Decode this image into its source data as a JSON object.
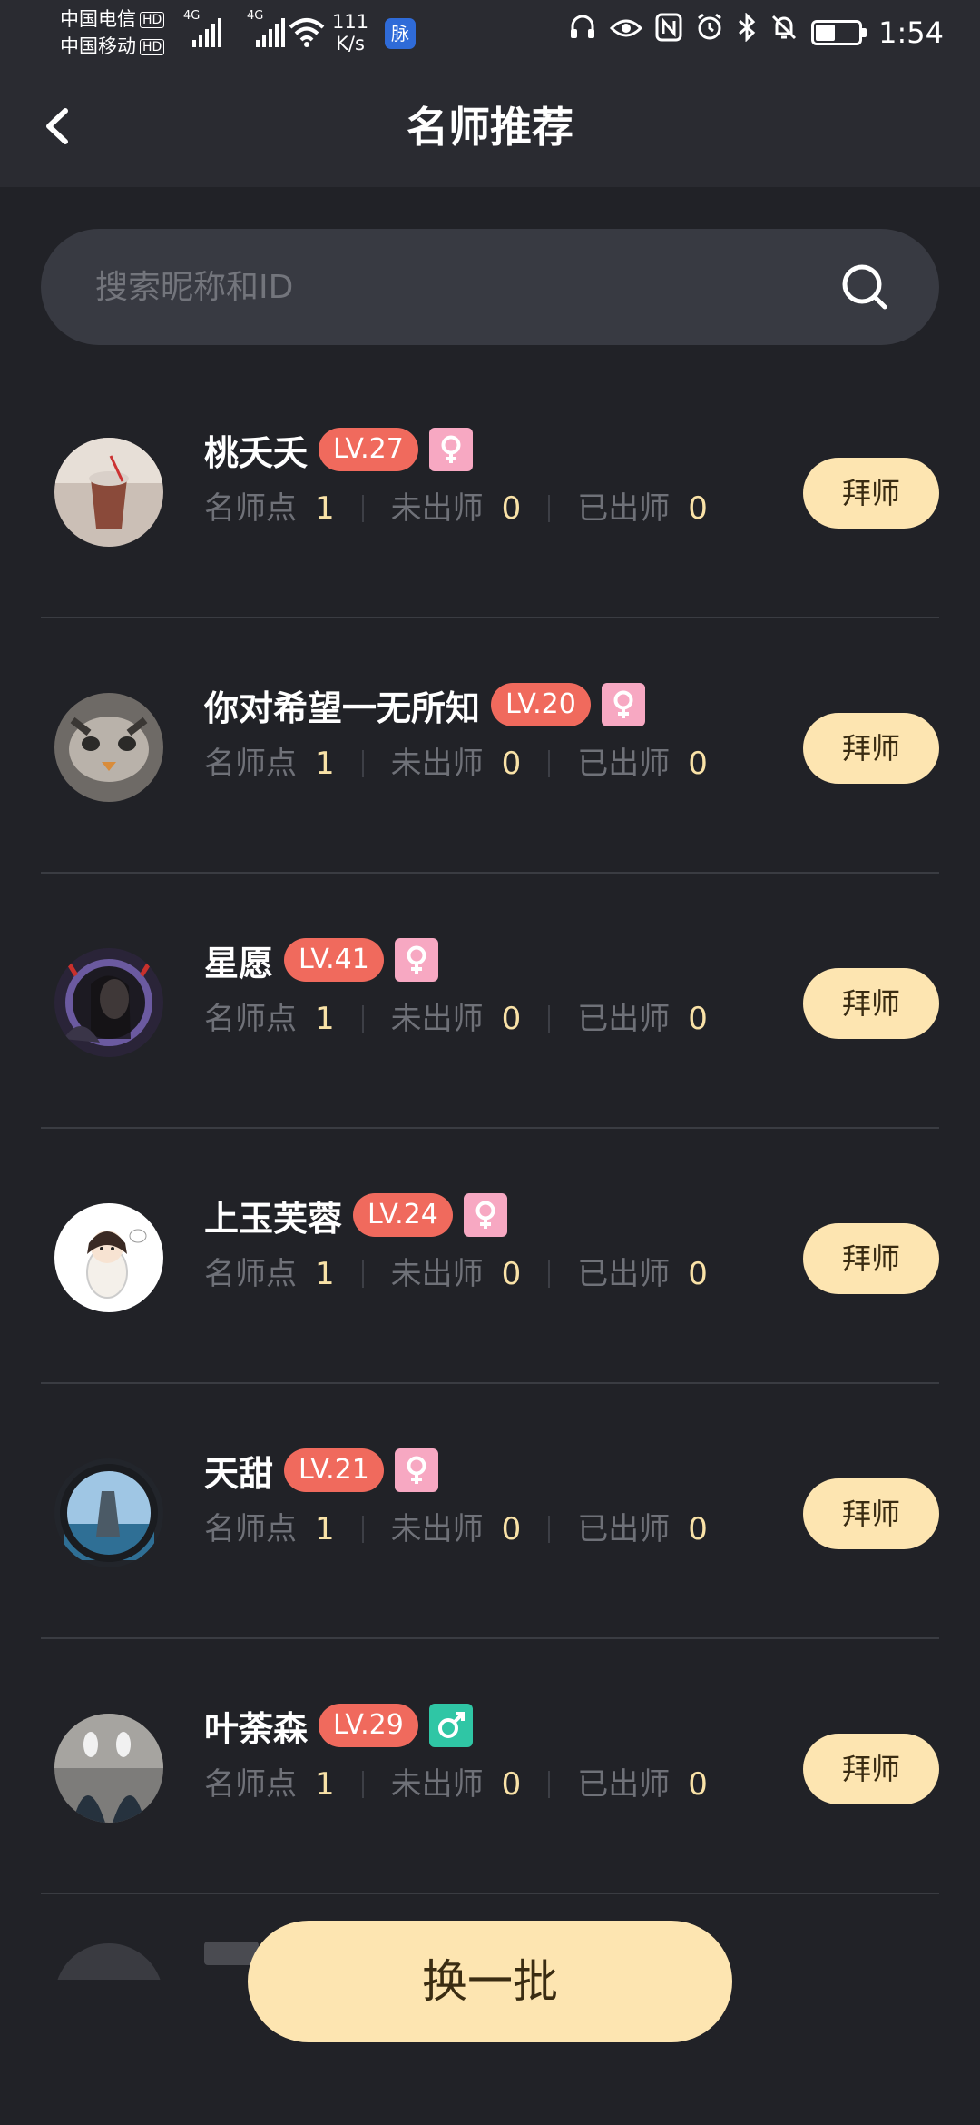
{
  "status_bar": {
    "carrier1": "中国电信",
    "carrier2": "中国移动",
    "hd": "HD",
    "net1": "4G",
    "net2": "4G",
    "speed_value": "111",
    "speed_unit": "K/s",
    "app_badge": "脉",
    "battery_level": 0.45,
    "time": "1:54",
    "icons": [
      "headphones-icon",
      "eye-icon",
      "nfc-icon",
      "alarm-icon",
      "bluetooth-icon",
      "mute-icon",
      "battery-icon"
    ]
  },
  "nav": {
    "title": "名师推荐",
    "back_icon": "chevron-left-icon"
  },
  "search": {
    "placeholder": "搜索昵称和ID",
    "value": "",
    "icon": "search-icon"
  },
  "labels": {
    "points": "名师点",
    "unfinished": "未出师",
    "finished": "已出师",
    "apprentice_button": "拜师",
    "swap_button": "换一批"
  },
  "masters": [
    {
      "name": "桃夭夭",
      "level": "LV.27",
      "gender": "female",
      "gender_symbol": "♀",
      "points": "1",
      "unfinished": "0",
      "finished": "0"
    },
    {
      "name": "你对希望一无所知",
      "level": "LV.20",
      "gender": "female",
      "gender_symbol": "♀",
      "points": "1",
      "unfinished": "0",
      "finished": "0"
    },
    {
      "name": "星愿",
      "level": "LV.41",
      "gender": "female",
      "gender_symbol": "♀",
      "points": "1",
      "unfinished": "0",
      "finished": "0"
    },
    {
      "name": "上玉芙蓉",
      "level": "LV.24",
      "gender": "female",
      "gender_symbol": "♀",
      "points": "1",
      "unfinished": "0",
      "finished": "0"
    },
    {
      "name": "天甜",
      "level": "LV.21",
      "gender": "female",
      "gender_symbol": "♀",
      "points": "1",
      "unfinished": "0",
      "finished": "0"
    },
    {
      "name": "叶荼森",
      "level": "LV.29",
      "gender": "male",
      "gender_symbol": "♂",
      "points": "1",
      "unfinished": "0",
      "finished": "0"
    }
  ],
  "colors": {
    "background": "#212227",
    "header": "#2a2b31",
    "level_badge": "#f06a5d",
    "female": "#f7a8c2",
    "male": "#2fc6a5",
    "button": "#fde5b1",
    "value_text": "#f9e2a7"
  }
}
